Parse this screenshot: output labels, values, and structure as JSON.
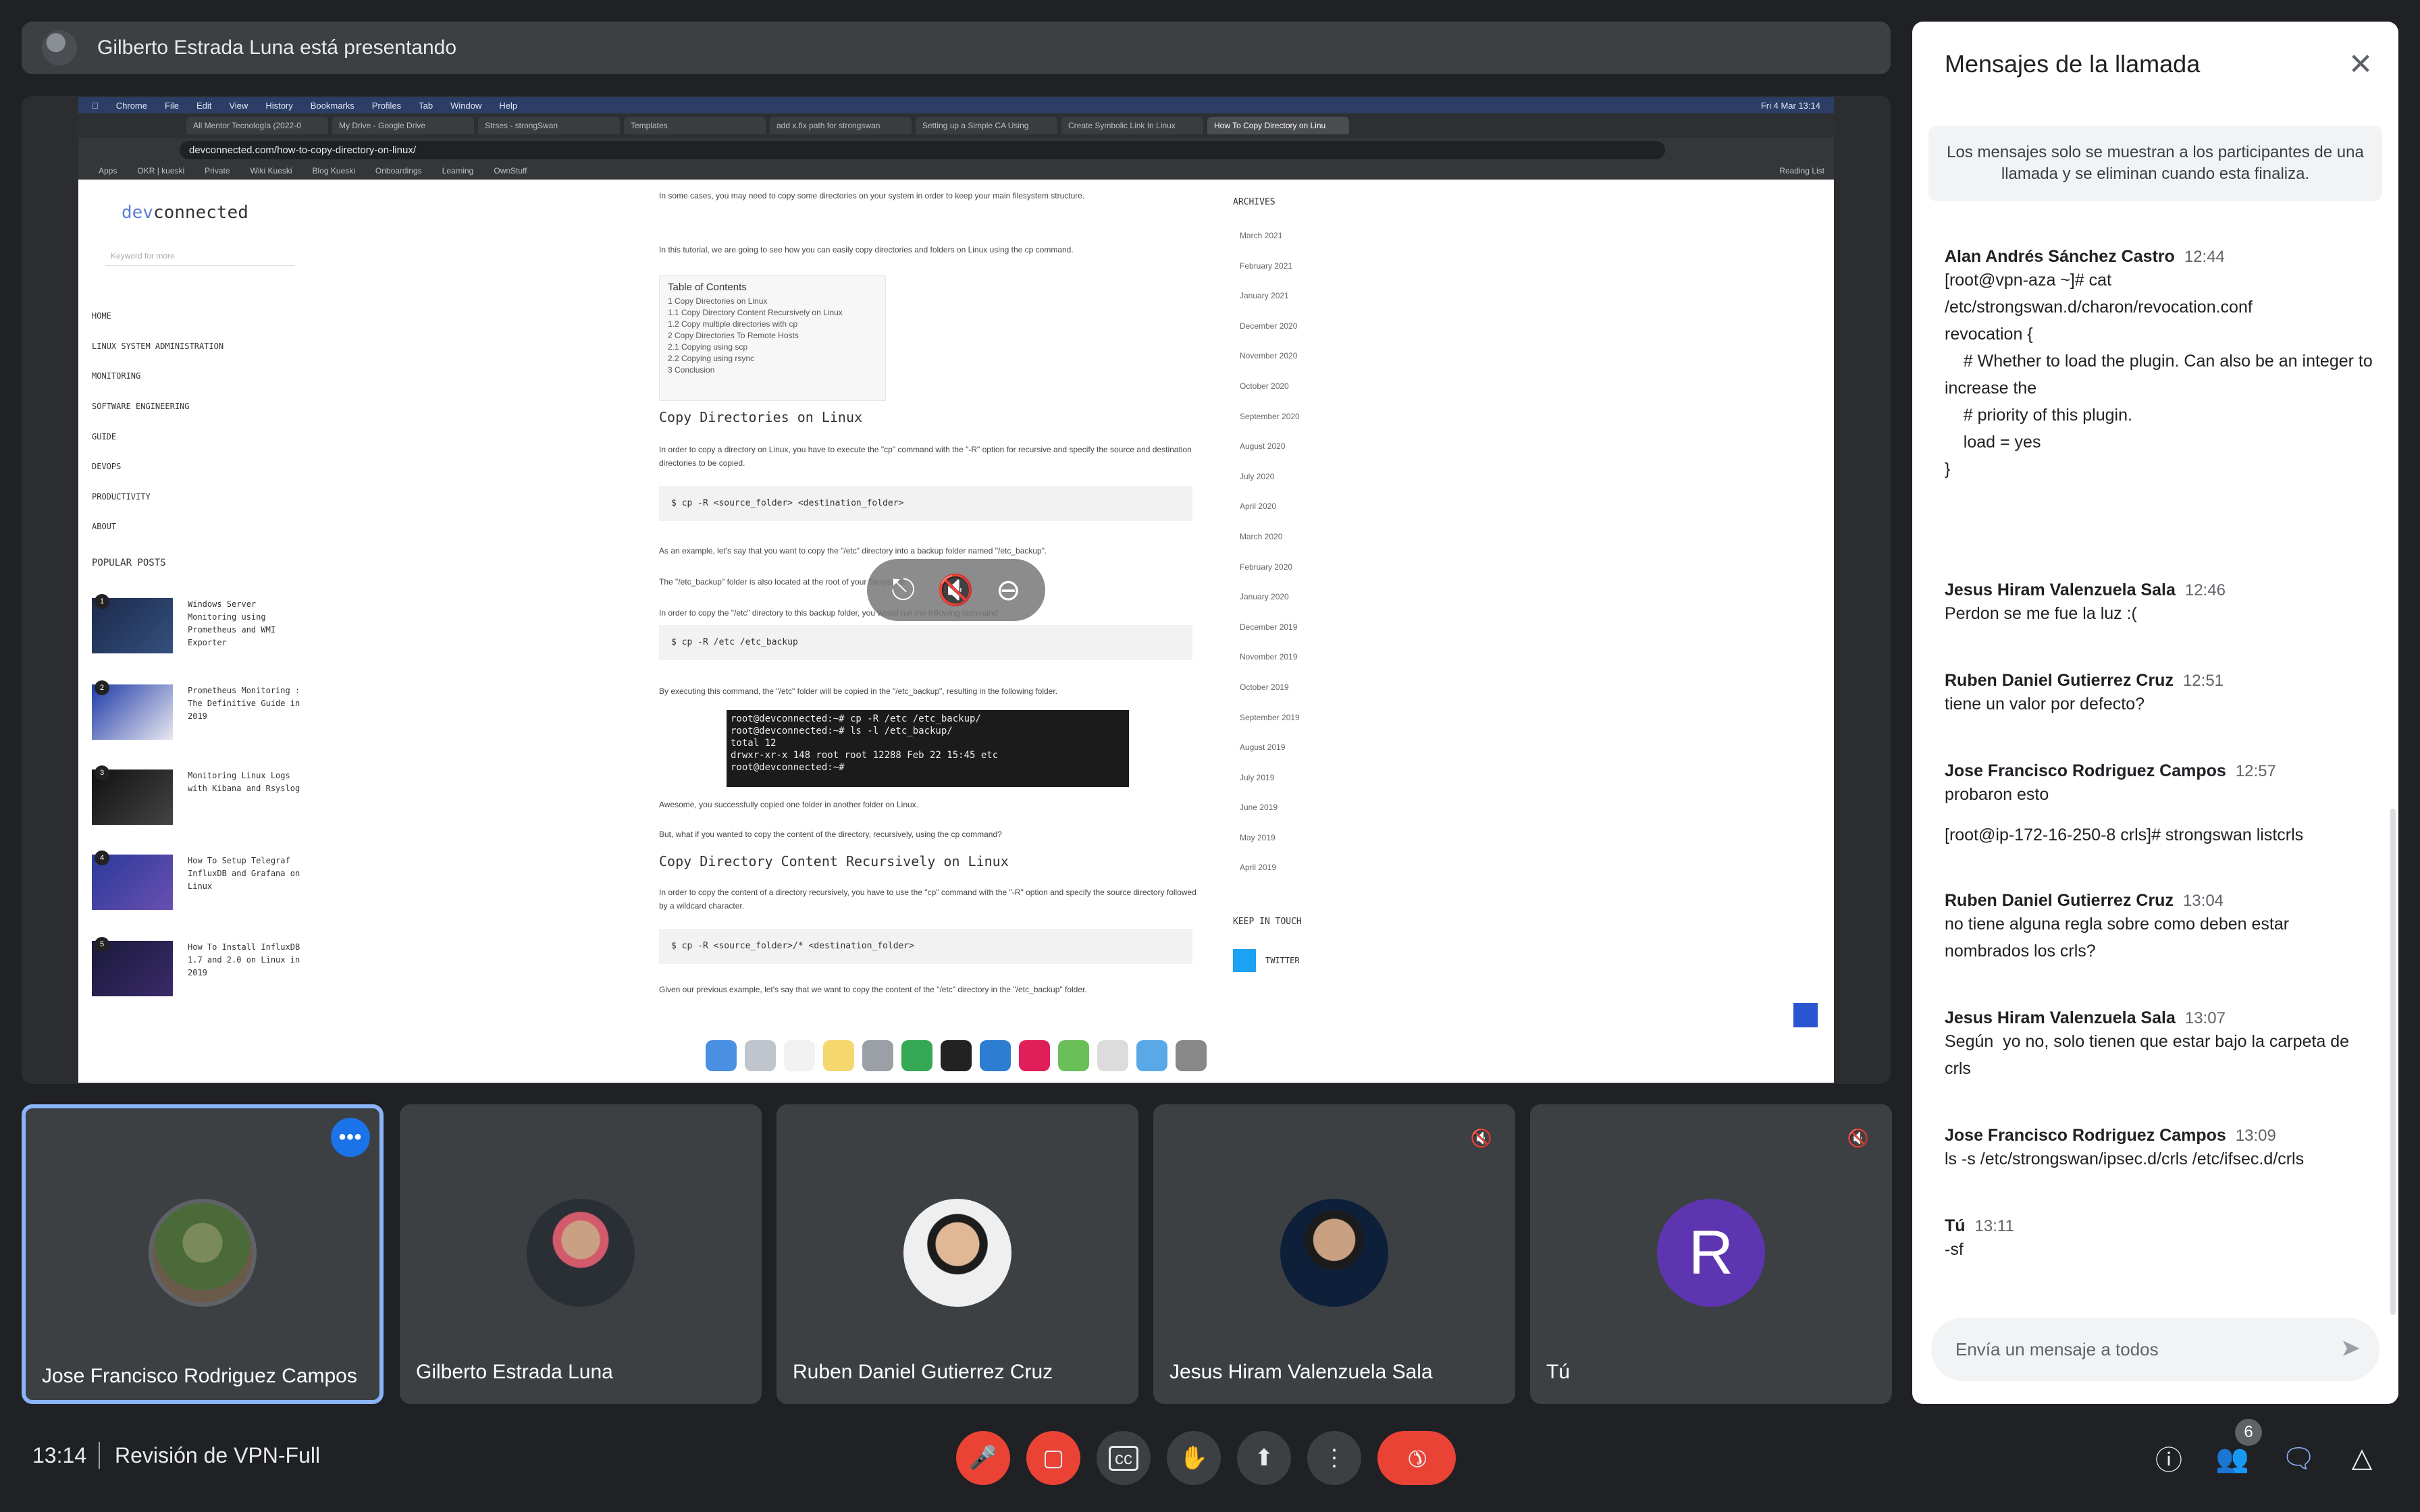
{
  "presenter_bar": {
    "text": "Gilberto Estrada Luna está presentando"
  },
  "shared_screen": {
    "menubar": {
      "items": [
        "Chrome",
        "File",
        "Edit",
        "View",
        "History",
        "Bookmarks",
        "Profiles",
        "Tab",
        "Window",
        "Help"
      ],
      "clock": "Fri 4 Mar  13:14"
    },
    "tabs": [
      "All Mentor Tecnología (2022-0",
      "My Drive - Google Drive",
      "Strses - strongSwan",
      "Templates",
      "add x.fix path for strongswan",
      "Setting up a Simple CA Using",
      "Create Symbolic Link In Linux",
      "How To Copy Directory on Linu"
    ],
    "url": "devconnected.com/how-to-copy-directory-on-linux/",
    "bookmarks": [
      "Apps",
      "OKR | kueski",
      "Private",
      "Wiki Kueski",
      "Blog Kueski",
      "Onboardings",
      "Learning",
      "OwnStuff"
    ],
    "reading_list": "Reading List",
    "site_logo_a": "dev",
    "site_logo_b": "connected",
    "site_search_placeholder": "Keyword for more",
    "nav": [
      "HOME",
      "LINUX SYSTEM ADMINISTRATION",
      "MONITORING",
      "SOFTWARE ENGINEERING",
      "GUIDE",
      "DEVOPS",
      "PRODUCTIVITY",
      "ABOUT"
    ],
    "popular_posts_heading": "POPULAR POSTS",
    "popular_posts": [
      "Windows Server Monitoring using Prometheus and WMI Exporter",
      "Prometheus Monitoring : The Definitive Guide in 2019",
      "Monitoring Linux Logs with Kibana and Rsyslog",
      "How To Setup Telegraf InfluxDB and Grafana on Linux",
      "How To Install InfluxDB 1.7 and 2.0 on Linux in 2019"
    ],
    "article": {
      "intro_1": "In some cases, you may need to copy some directories on your system in order to keep your main filesystem structure.",
      "intro_2": "In this tutorial, we are going to see how you can easily copy directories and folders on Linux using the cp command.",
      "toc_title": "Table of Contents",
      "toc": [
        "1  Copy Directories on Linux",
        "  1.1 Copy Directory Content Recursively on Linux",
        "  1.2 Copy multiple directories with cp",
        "2  Copy Directories To Remote Hosts",
        "  2.1 Copying using scp",
        "  2.2 Copying using rsync",
        "3  Conclusion"
      ],
      "h_copy": "Copy Directories on Linux",
      "p_copy": "In order to copy a directory on Linux, you have to execute the \"cp\" command with the \"-R\" option for recursive and specify the source and destination directories to be copied.",
      "code_1": "$ cp -R <source_folder> <destination_folder>",
      "p_example": "As an example, let's say that you want to copy the \"/etc\" directory into a backup folder named \"/etc_backup\".",
      "p_located": "The \"/etc_backup\" folder is also located at the root of your filesystem.",
      "p_order": "In order to copy the \"/etc\" directory to this backup folder, you would run the following command",
      "code_2": "$ cp -R /etc /etc_backup",
      "p_executing": "By executing this command, the \"/etc\" folder will be copied in the \"/etc_backup\", resulting in the following folder.",
      "terminal": "root@devconnected:~# cp -R /etc /etc_backup/\nroot@devconnected:~# ls -l /etc_backup/\ntotal 12\ndrwxr-xr-x 148 root root 12288 Feb 22 15:45 etc\nroot@devconnected:~#",
      "p_awesome": "Awesome, you successfully copied one folder in another folder on Linux.",
      "p_but": "But, what if you wanted to copy the content of the directory, recursively, using the cp command?",
      "h_recursive": "Copy Directory Content Recursively on Linux",
      "p_recursive": "In order to copy the content of a directory recursively, you have to use the \"cp\" command with the \"-R\" option and specify the source directory followed by a wildcard character.",
      "code_3": "$ cp -R <source_folder>/* <destination_folder>",
      "p_given": "Given our previous example, let's say that we want to copy the content of the \"/etc\" directory in the \"/etc_backup\" folder."
    },
    "archives_heading": "ARCHIVES",
    "archives": [
      "March 2021",
      "February 2021",
      "January 2021",
      "December 2020",
      "November 2020",
      "October 2020",
      "September 2020",
      "August 2020",
      "July 2020",
      "April 2020",
      "March 2020",
      "February 2020",
      "January 2020",
      "December 2019",
      "November 2019",
      "October 2019",
      "September 2019",
      "August 2019",
      "July 2019",
      "June 2019",
      "May 2019",
      "April 2019"
    ],
    "keep_in_touch": "KEEP IN TOUCH",
    "twitter": "TWITTER",
    "overlay_icons": [
      "unpin-icon",
      "mute-icon",
      "remove-icon"
    ]
  },
  "participants": [
    {
      "name": "Jose Francisco Rodriguez Campos",
      "active": true,
      "muted": false
    },
    {
      "name": "Gilberto Estrada Luna",
      "active": false,
      "muted": false
    },
    {
      "name": "Ruben Daniel Gutierrez Cruz",
      "active": false,
      "muted": false
    },
    {
      "name": "Jesus Hiram Valenzuela Sala",
      "active": false,
      "muted": true
    },
    {
      "name": "Tú",
      "initial": "R",
      "avatar_color": "#5e35b1",
      "active": false,
      "muted": true
    }
  ],
  "bottom_bar": {
    "time": "13:14",
    "meeting_title": "Revisión de VPN-Full",
    "people_count": "6",
    "controls": [
      "mic-off-icon",
      "camera-off-icon",
      "captions-icon",
      "raise-hand-icon",
      "present-icon",
      "more-options-icon",
      "hang-up-icon"
    ],
    "right_controls": [
      "info-icon",
      "people-icon",
      "chat-icon",
      "activities-icon"
    ],
    "colors": {
      "danger": "#ea4335",
      "chat_active": "#8ab4f8"
    }
  },
  "chat": {
    "title": "Mensajes de la llamada",
    "notice": "Los mensajes solo se muestran a los participantes de una llamada y se eliminan cuando esta finaliza.",
    "messages": [
      {
        "sender": "Alan Andrés Sánchez Castro",
        "time": "12:44",
        "lines": [
          "[root@vpn-aza ~]# cat /etc/strongswan.d/charon/revocation.conf",
          "revocation {",
          "",
          "    # Whether to load the plugin. Can also be an integer to increase the",
          "    # priority of this plugin.",
          "    load = yes",
          "",
          "}"
        ]
      },
      {
        "sender": "Jesus Hiram Valenzuela Sala",
        "time": "12:46",
        "lines": [
          "Perdon se me fue la luz :("
        ]
      },
      {
        "sender": "Ruben Daniel Gutierrez Cruz",
        "time": "12:51",
        "lines": [
          "tiene un valor por defecto?"
        ]
      },
      {
        "sender": "Jose Francisco Rodriguez Campos",
        "time": "12:57",
        "lines": [
          "probaron esto",
          "",
          "[root@ip-172-16-250-8 crls]# strongswan listcrls"
        ]
      },
      {
        "sender": "Ruben Daniel Gutierrez Cruz",
        "time": "13:04",
        "lines": [
          "no tiene alguna regla sobre como deben estar nombrados los crls?"
        ]
      },
      {
        "sender": "Jesus Hiram Valenzuela Sala",
        "time": "13:07",
        "lines": [
          "Según  yo no, solo tienen que estar bajo la carpeta de crls"
        ]
      },
      {
        "sender": "Jose Francisco Rodriguez Campos",
        "time": "13:09",
        "lines": [
          "ls -s /etc/strongswan/ipsec.d/crls /etc/ifsec.d/crls"
        ]
      },
      {
        "sender": "Tú",
        "time": "13:11",
        "lines": [
          "-sf"
        ]
      }
    ],
    "input_placeholder": "Envía un mensaje a todos"
  }
}
